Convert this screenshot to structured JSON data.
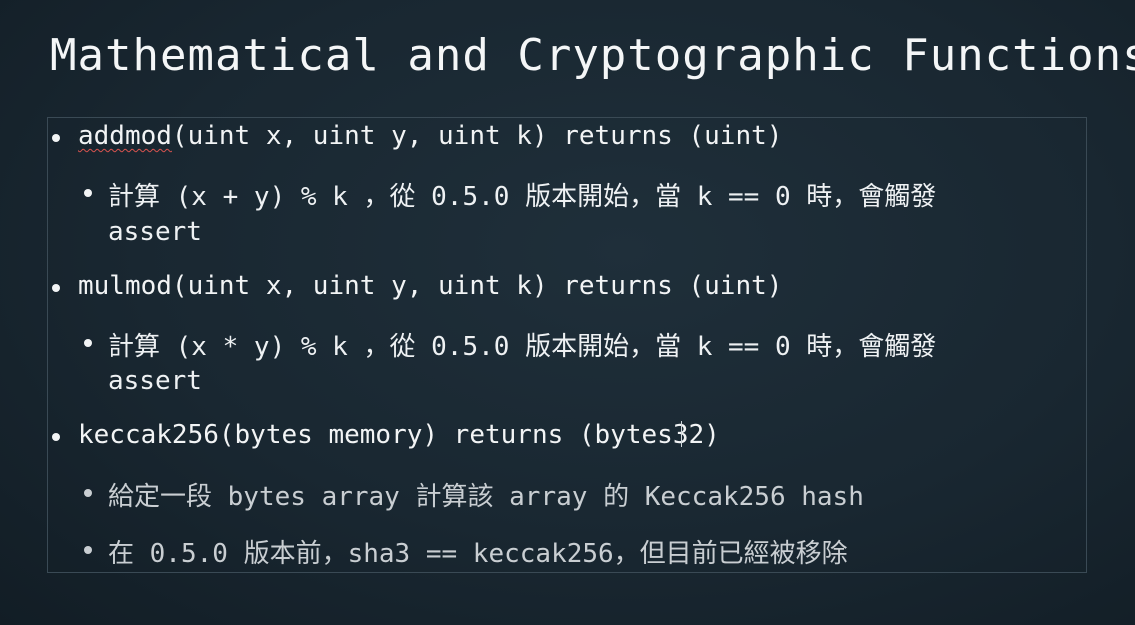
{
  "slide": {
    "title": "Mathematical and Cryptographic Functions",
    "items": [
      {
        "name": "addmod",
        "rest": "(uint x, uint y, uint k) returns (uint)",
        "sub": {
          "line1": "計算 (x + y) % k ，從 0.5.0 版本開始，當 k == 0 時，會觸發",
          "line2": "assert"
        }
      },
      {
        "full": "mulmod(uint x, uint y, uint k) returns (uint)",
        "sub": {
          "line1": "計算 (x * y) % k ，從 0.5.0 版本開始，當 k == 0 時，會觸發",
          "line2": "assert"
        }
      },
      {
        "pre": "keccak256(bytes memory) returns (bytes3",
        "post": "2)",
        "subs": [
          "給定一段 bytes array 計算該 array 的 Keccak256 hash",
          "在 0.5.0 版本前，sha3 == keccak256，但目前已經被移除"
        ]
      }
    ]
  },
  "colors": {
    "background": "#192731",
    "text": "#f2f4f5",
    "dim_text": "#c9ced2",
    "frame_border": "#3a4a55",
    "spellcheck_underline": "#d9534f"
  },
  "icons": {
    "bullet": "bullet-dot-icon",
    "cursor": "text-cursor-icon"
  }
}
